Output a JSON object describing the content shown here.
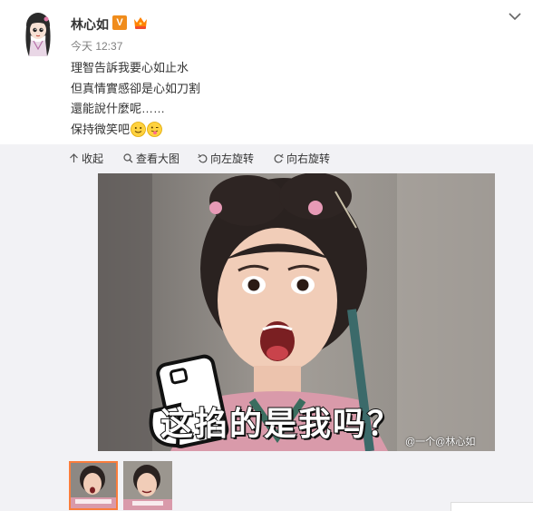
{
  "post": {
    "user_name": "林心如",
    "verified_mark": "V",
    "time": "今天 12:37",
    "lines": [
      "理智告訴我要心如止水",
      "但真情實感卻是心如刀割",
      "還能說什麼呢……",
      "保持微笑吧"
    ]
  },
  "toolbar": {
    "collapse": "收起",
    "view_large": "查看大图",
    "rotate_left": "向左旋转",
    "rotate_right": "向右旋转"
  },
  "image": {
    "caption": "这掐的是我吗？",
    "watermark": "@一个@林心如"
  },
  "colors": {
    "verified_badge": "#f08c1b",
    "thumb_active_border": "#fa7d3c",
    "panel_background": "#f2f2f5"
  },
  "icons": [
    "avatar",
    "verified-icon",
    "member-crown-icon",
    "chevron-down-icon",
    "smile-emoji-icon",
    "tongue-emoji-icon",
    "collapse-arrow-icon",
    "search-icon",
    "rotate-left-icon",
    "rotate-right-icon"
  ]
}
